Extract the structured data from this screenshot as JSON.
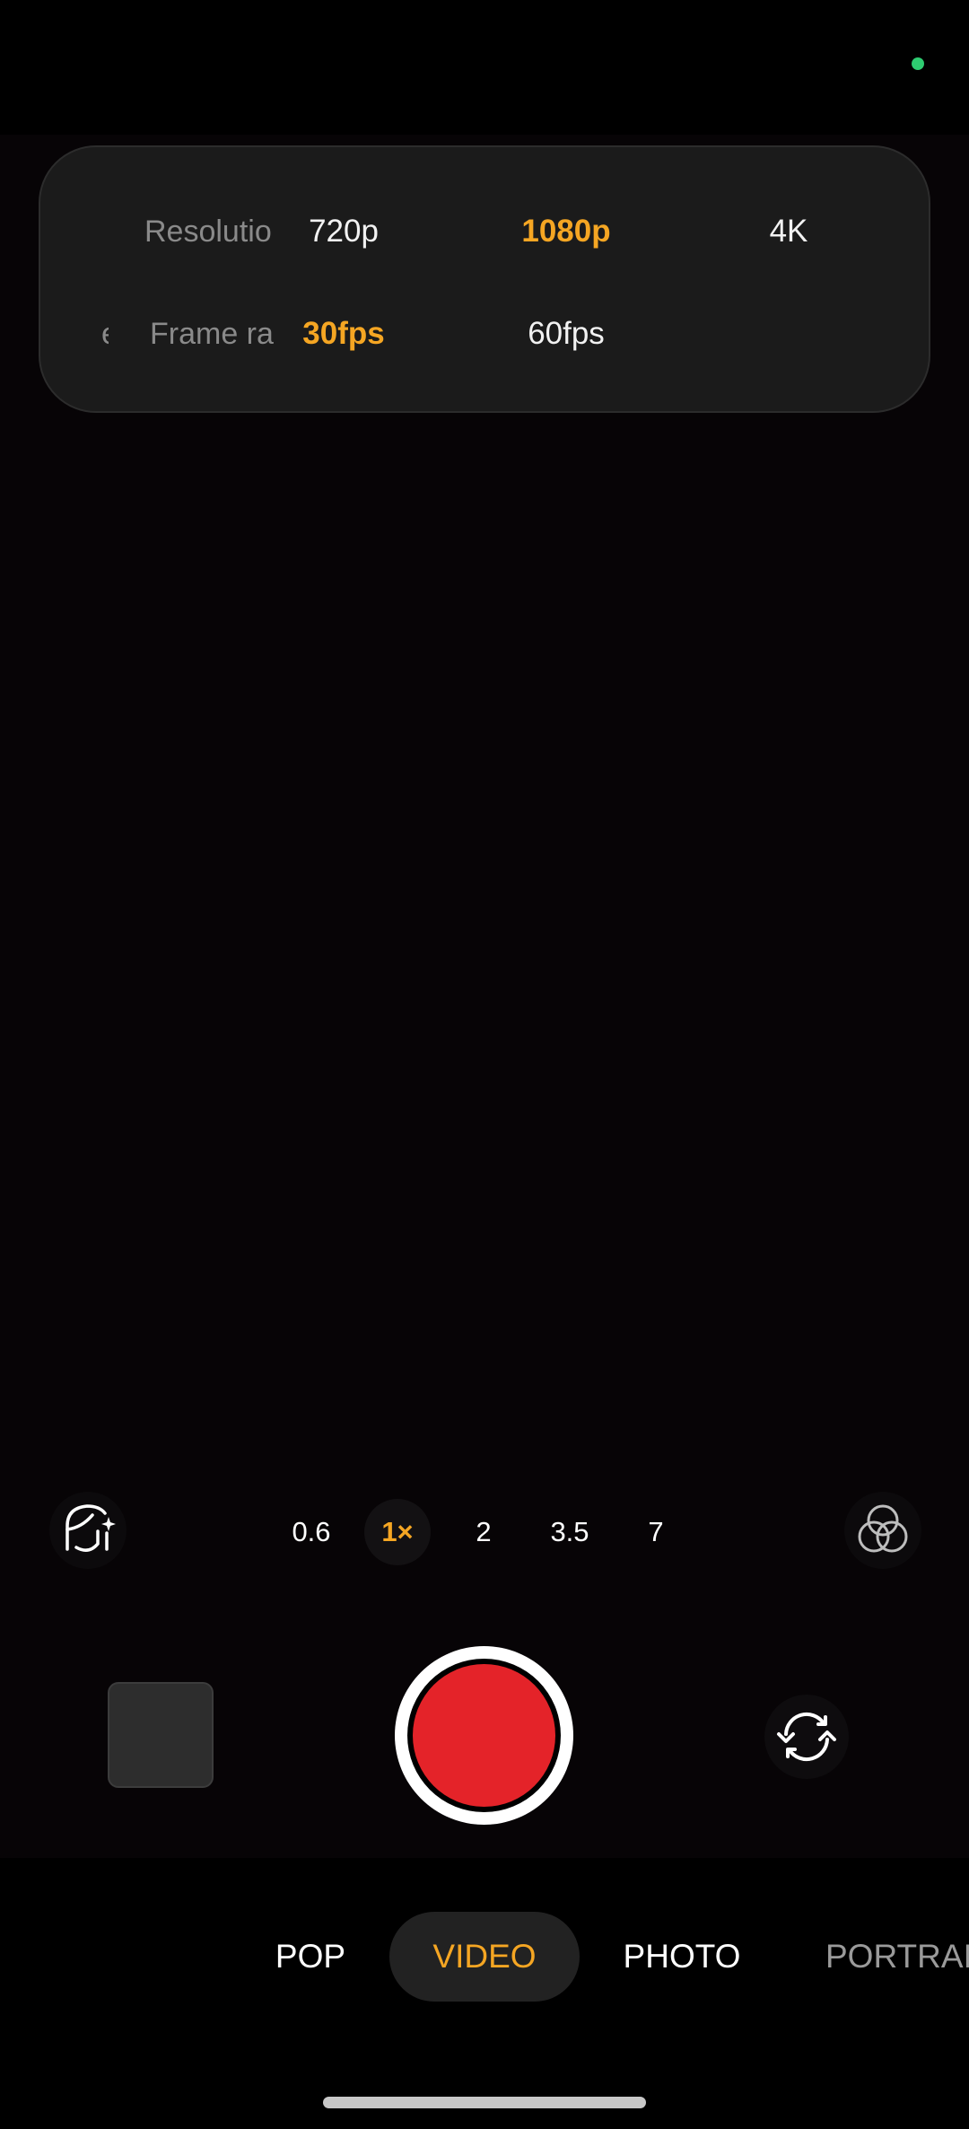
{
  "status_bar": {
    "privacy_dot_color": "#2ecc71"
  },
  "settings": {
    "rows": [
      {
        "label": "Resolution",
        "options": [
          "720p",
          "1080p",
          "4K"
        ],
        "selected": "1080p"
      },
      {
        "label": "Frame rate",
        "options": [
          "30fps",
          "60fps"
        ],
        "selected": "30fps"
      }
    ],
    "accent_color": "#f5a623"
  },
  "zoom": {
    "levels": [
      "0.6",
      "1×",
      "2",
      "3.5",
      "7"
    ],
    "selected": "1×",
    "left_icon": "beauty-face-icon",
    "right_icon": "filters-icon"
  },
  "capture": {
    "shutter_color": "#e42329",
    "flip_icon": "flip-camera-icon"
  },
  "modes": {
    "items": [
      "POP",
      "VIDEO",
      "PHOTO",
      "PORTRAIT"
    ],
    "selected": "VIDEO"
  }
}
